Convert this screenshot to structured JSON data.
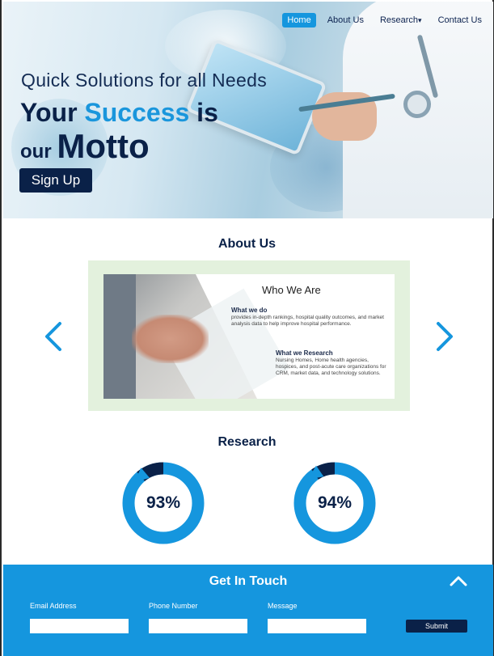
{
  "nav": {
    "items": [
      {
        "label": "Home",
        "active": true
      },
      {
        "label": "About Us"
      },
      {
        "label": "Research",
        "dropdown": "▾"
      },
      {
        "label": "Contact Us"
      }
    ]
  },
  "hero": {
    "tagline": "Quick Solutions for all Needs",
    "headline_part1": "Your ",
    "headline_accent": "Success",
    "headline_part2": " is",
    "headline_line2_small": "our ",
    "headline_line2_big": "Motto",
    "signup_label": "Sign Up"
  },
  "about": {
    "title": "About Us",
    "card": {
      "heading": "Who We Are",
      "what_we_do_title": "What we do",
      "what_we_do_text": "provides in-depth rankings, hospital quality outcomes, and market analysis data to help improve hospital performance.",
      "what_we_research_title": "What we Research",
      "what_we_research_text": "Nursing Homes, Home health agencies, hospices, and post-acute care organizations for CRM, market data, and technology solutions."
    }
  },
  "research": {
    "title": "Research",
    "stats": [
      {
        "value": "93%",
        "fraction": 0.93
      },
      {
        "value": "94%",
        "fraction": 0.94
      }
    ]
  },
  "footer": {
    "title": "Get In Touch",
    "email_label": "Email Address",
    "phone_label": "Phone Number",
    "message_label": "Message",
    "submit_label": "Submit"
  },
  "colors": {
    "primary_blue": "#1596de",
    "navy": "#0a2148",
    "about_bg": "#e3f1dd"
  }
}
